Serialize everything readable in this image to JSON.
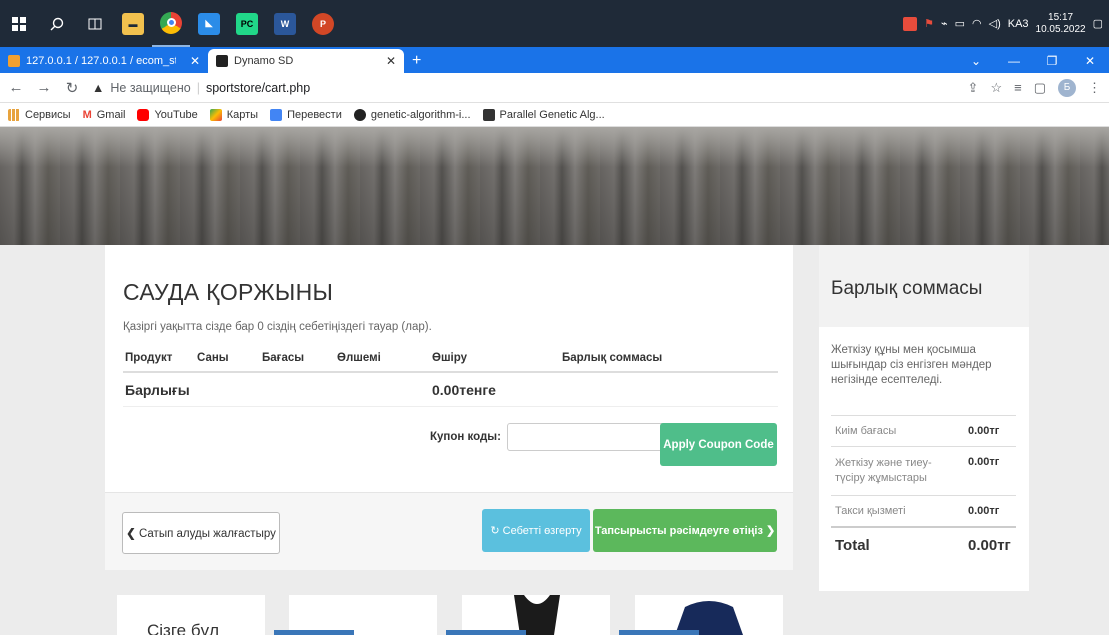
{
  "taskbar": {
    "icons": [
      "windows-start-icon",
      "search-icon",
      "task-view-icon",
      "file-explorer-icon",
      "chrome-icon",
      "vscode-icon",
      "pycharm-icon",
      "word-icon",
      "powerpoint-icon"
    ],
    "tray": {
      "language": "KA3",
      "time": "15:17",
      "date": "10.05.2022"
    }
  },
  "browser": {
    "tabs": [
      {
        "title": "127.0.0.1 / 127.0.0.1 / ecom_store"
      },
      {
        "title": "Dynamo SD"
      }
    ],
    "new_tab": "+",
    "address": {
      "security": "Не защищено",
      "url": "sportstore/cart.php"
    },
    "bookmarks": [
      "Сервисы",
      "Gmail",
      "YouTube",
      "Карты",
      "Перевести",
      "genetic-algorithm-i...",
      "Parallel Genetic Alg..."
    ]
  },
  "cart": {
    "title": "САУДА ҚОРЖЫНЫ",
    "subtitle": "Қазіргі уақытта сізде бар 0 сіздің себетіңіздегі тауар (лар).",
    "columns": [
      "Продукт",
      "Саны",
      "Бағасы",
      "Өлшемі",
      "Өшіру",
      "Барлық соммасы"
    ],
    "total_label": "Барлығы",
    "total_value": "0.00тенге",
    "coupon_label": "Купон коды:",
    "coupon_value": "",
    "coupon_button": "Apply Coupon Code",
    "continue_button": "Сатып алуды жалғастыру",
    "update_button": "Себетті өзгерту",
    "checkout_button": "Тапсырысты рәсімдеуге өтіңіз"
  },
  "summary": {
    "title": "Барлық соммасы",
    "note": "Жеткізу құны мен қосымша шығындар сіз енгізген мәндер негізінде есептеледі.",
    "rows": [
      {
        "label": "Киім бағасы",
        "value": "0.00тг"
      },
      {
        "label": "Жеткізу және тиеу-түсіру жұмыстары",
        "value": "0.00тг"
      },
      {
        "label": "Такси қызметі",
        "value": "0.00тг"
      }
    ],
    "total_label": "Total",
    "total_value": "0.00тг"
  },
  "teaser": {
    "text": "Сізге бұл"
  },
  "colors": {
    "accent_blue": "#1a73e8",
    "success": "#5cb85c",
    "info": "#5bc0de",
    "coupon": "#4fbe8a"
  }
}
